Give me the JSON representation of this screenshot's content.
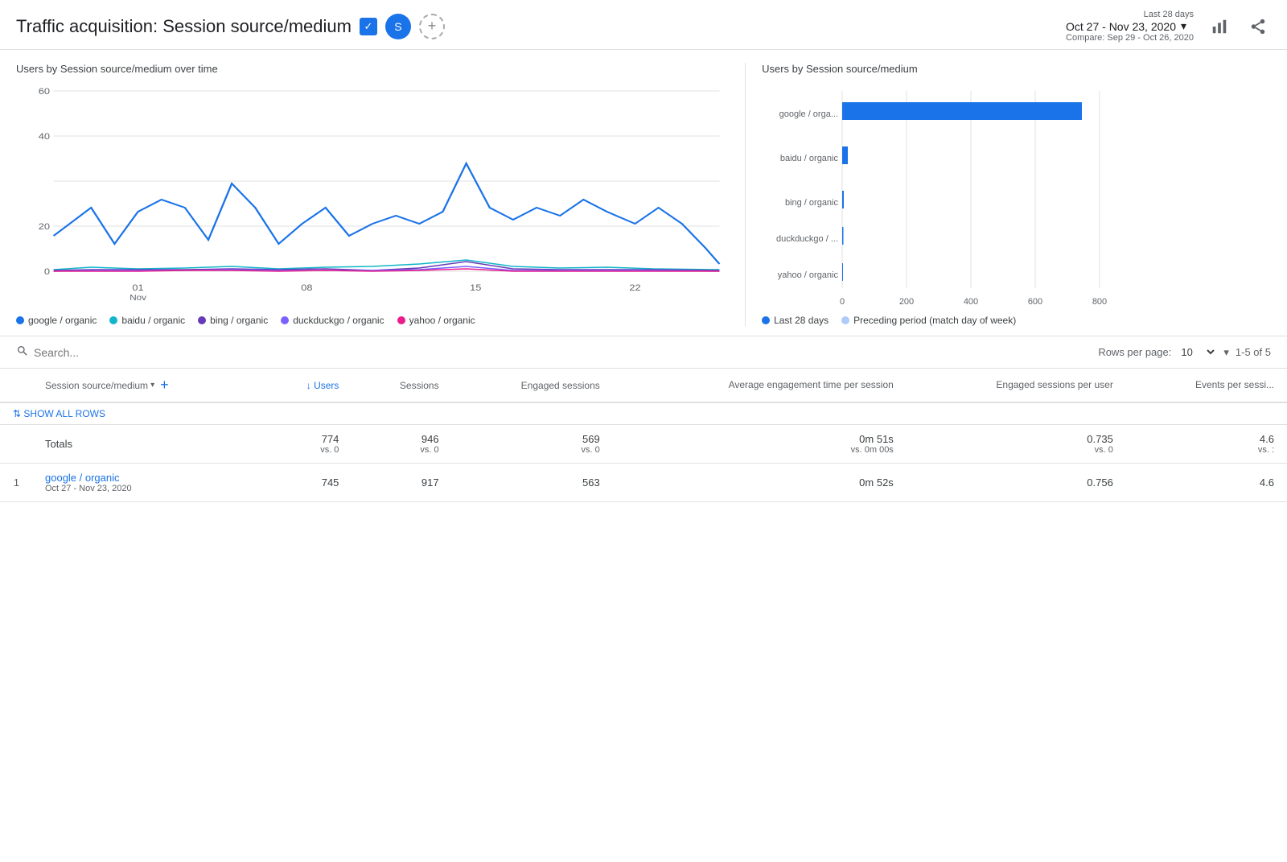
{
  "header": {
    "title": "Traffic acquisition: Session source/medium",
    "title_icon": "✓",
    "avatar_label": "S",
    "date_range_label": "Last 28 days",
    "date_range_main": "Oct 27 - Nov 23, 2020",
    "date_compare": "Compare: Sep 29 - Oct 26, 2020",
    "add_button_label": "+"
  },
  "charts": {
    "left_title": "Users by Session source/medium over time",
    "right_title": "Users by Session source/medium",
    "left_legend": [
      {
        "label": "google / organic",
        "color": "#1a73e8"
      },
      {
        "label": "baidu / organic",
        "color": "#12b5cb"
      },
      {
        "label": "bing / organic",
        "color": "#673ab7"
      },
      {
        "label": "duckduckgo / organic",
        "color": "#7b61ff"
      },
      {
        "label": "yahoo / organic",
        "color": "#e91e8c"
      }
    ],
    "right_legend": [
      {
        "label": "Last 28 days",
        "color": "#1a73e8"
      },
      {
        "label": "Preceding period (match day of week)",
        "color": "#aecbfa"
      }
    ],
    "bar_data": [
      {
        "label": "google / orga...",
        "value": 745,
        "max": 800
      },
      {
        "label": "baidu / organic",
        "value": 18,
        "max": 800
      },
      {
        "label": "bing / organic",
        "value": 5,
        "max": 800
      },
      {
        "label": "duckduckgo / ...",
        "value": 3,
        "max": 800
      },
      {
        "label": "yahoo / organic",
        "value": 2,
        "max": 800
      }
    ],
    "bar_x_labels": [
      "0",
      "200",
      "400",
      "600",
      "800"
    ]
  },
  "table": {
    "search_placeholder": "Search...",
    "rows_per_page_label": "Rows per page:",
    "rows_per_page_value": "10",
    "pagination": "1-5 of 5",
    "show_all_rows": "SHOW ALL ROWS",
    "columns": [
      {
        "id": "dimension",
        "label": "Session source/medium",
        "sort": "asc",
        "active": false
      },
      {
        "id": "users",
        "label": "↓ Users",
        "sort": "desc",
        "active": true
      },
      {
        "id": "sessions",
        "label": "Sessions",
        "sort": null,
        "active": false
      },
      {
        "id": "engaged_sessions",
        "label": "Engaged sessions",
        "sort": null,
        "active": false
      },
      {
        "id": "avg_engagement",
        "label": "Average engagement time per session",
        "sort": null,
        "active": false
      },
      {
        "id": "engaged_per_user",
        "label": "Engaged sessions per user",
        "sort": null,
        "active": false
      },
      {
        "id": "events_per_session",
        "label": "Events per sessi...",
        "sort": null,
        "active": false
      }
    ],
    "totals": {
      "label": "Totals",
      "users": "774",
      "users_vs": "vs. 0",
      "sessions": "946",
      "sessions_vs": "vs. 0",
      "engaged_sessions": "569",
      "engaged_sessions_vs": "vs. 0",
      "avg_engagement": "0m 51s",
      "avg_engagement_vs": "vs. 0m 00s",
      "engaged_per_user": "0.735",
      "engaged_per_user_vs": "vs. 0",
      "events_per_session": "4.6",
      "events_per_session_vs": "vs. :"
    },
    "rows": [
      {
        "num": "1",
        "dimension": "google / organic",
        "dimension_sub": "Oct 27 - Nov 23, 2020",
        "users": "745",
        "sessions": "917",
        "engaged_sessions": "563",
        "avg_engagement": "0m 52s",
        "engaged_per_user": "0.756",
        "events_per_session": "4.6"
      }
    ]
  }
}
